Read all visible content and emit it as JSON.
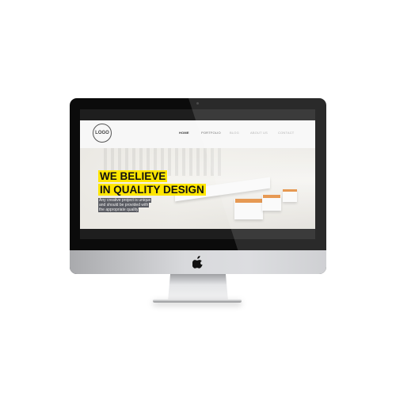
{
  "device": {
    "brand_icon": "apple-logo-icon",
    "bezel_color": "#0b0b0b",
    "chin_color": "#d8d9dc"
  },
  "website": {
    "logo": "LOGO",
    "nav": [
      {
        "label": "HOME",
        "active": true
      },
      {
        "label": "PORTFOLIO",
        "active": false
      },
      {
        "label": "BLOG",
        "active": false
      },
      {
        "label": "ABOUT US",
        "active": false
      },
      {
        "label": "CONTACT",
        "active": false
      }
    ],
    "hero": {
      "headline_1": "WE BELIEVE",
      "headline_2": "IN QUALITY DESIGN",
      "body_1": "Any creative project is unique",
      "body_2": "and should be provided with",
      "body_3": "the appropriate quality",
      "accent_color": "#ffe600"
    }
  }
}
